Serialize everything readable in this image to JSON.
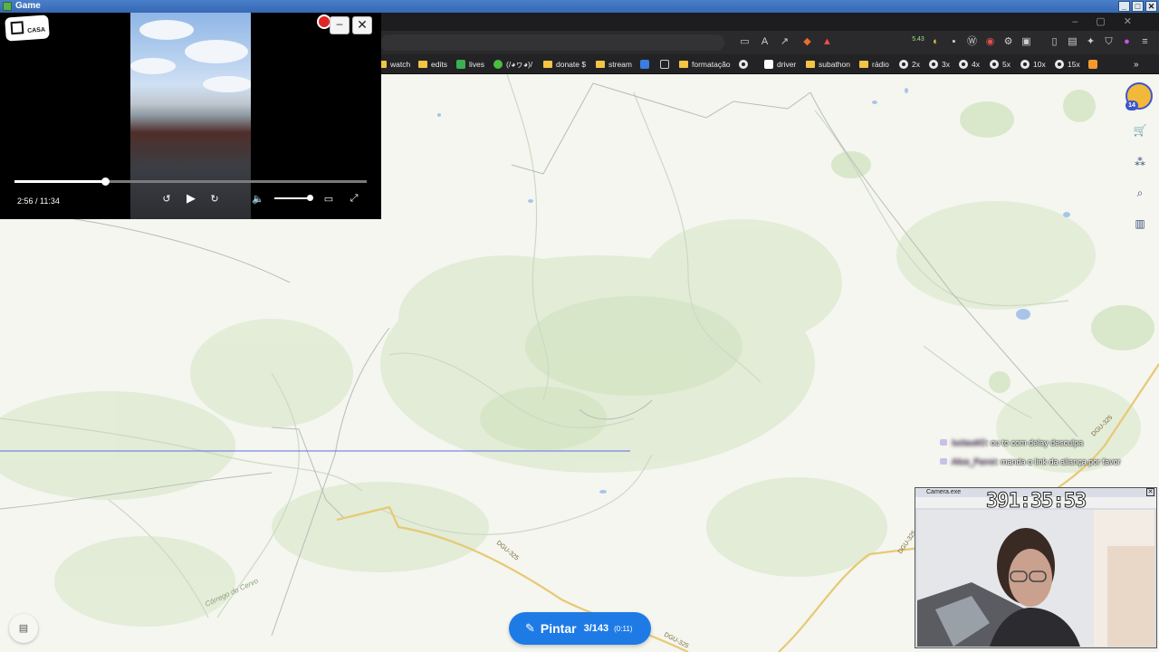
{
  "window": {
    "title": "Game"
  },
  "bookmarks": [
    {
      "label": "watch",
      "icon": "folder-icon"
    },
    {
      "label": "edits",
      "icon": "folder-icon"
    },
    {
      "label": "lives",
      "icon": "plus-icon"
    },
    {
      "label": "(/◕ヮ◕)/",
      "icon": "green-leaf-icon"
    },
    {
      "label": "donate $",
      "icon": "folder-icon"
    },
    {
      "label": "stream",
      "icon": "folder-icon"
    },
    {
      "label": "formatação",
      "icon": "folder-icon"
    },
    {
      "label": "driver",
      "icon": "white-square-icon"
    },
    {
      "label": "subathon",
      "icon": "folder-icon"
    },
    {
      "label": "rádio",
      "icon": "folder-icon"
    },
    {
      "label": "2x",
      "icon": "speed-icon"
    },
    {
      "label": "3x",
      "icon": "speed-icon"
    },
    {
      "label": "4x",
      "icon": "speed-icon"
    },
    {
      "label": "5x",
      "icon": "speed-icon"
    },
    {
      "label": "10x",
      "icon": "speed-icon"
    },
    {
      "label": "15x",
      "icon": "speed-icon"
    }
  ],
  "toolbar": {
    "extension_badge": "5.43"
  },
  "video": {
    "logo_text": "CASA",
    "time": "2:56 / 11:34",
    "progress_fraction": 0.258,
    "volume_fraction": 0.95
  },
  "map": {
    "road_labels": [
      "DGU-325",
      "DGU-325",
      "DGU-325",
      "DGU-325"
    ],
    "stream_label": "Córrego do Cervo"
  },
  "user": {
    "level": "14"
  },
  "paint": {
    "label": "Pintar",
    "count": "3/143",
    "timer": "(0:11)"
  },
  "chat": [
    {
      "user": "luclaudiO",
      "message": ": ou to com delay desculpa"
    },
    {
      "user": "Alice_Parrot",
      "message": ": manda o link da aliança por favor"
    }
  ],
  "webcam": {
    "title": "Camera.exe",
    "timer": "391:35:53"
  }
}
